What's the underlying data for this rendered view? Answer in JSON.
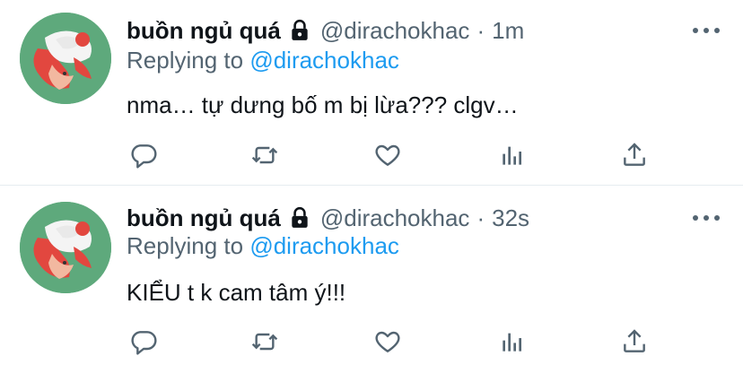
{
  "tweets": [
    {
      "author_name": "buồn ngủ quá",
      "handle": "@dirachokhac",
      "separator": "·",
      "time": "1m",
      "replying_prefix": "Replying to",
      "replying_to": "@dirachokhac",
      "text": "nma… tự dưng bố m bị lừa??? clgv…"
    },
    {
      "author_name": "buồn ngủ quá",
      "handle": "@dirachokhac",
      "separator": "·",
      "time": "32s",
      "replying_prefix": "Replying to",
      "replying_to": "@dirachokhac",
      "text": "KIỂU t k cam tâm ý!!!"
    }
  ],
  "icons": {
    "lock": "lock-icon",
    "more": "more-horizontal-icon",
    "reply": "reply-icon",
    "retweet": "retweet-icon",
    "like": "heart-icon",
    "analytics": "analytics-icon",
    "share": "share-icon"
  },
  "colors": {
    "text_primary": "#0f1419",
    "text_secondary": "#536471",
    "link": "#1d9bf0",
    "avatar_bg": "#5ea97c",
    "divider": "#e6ecf0"
  }
}
